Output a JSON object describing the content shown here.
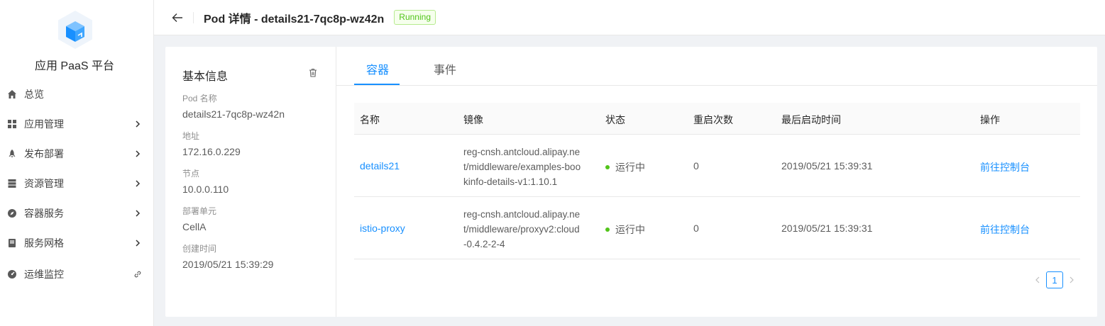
{
  "colors": {
    "primary": "#1890ff",
    "success": "#52c41a"
  },
  "sidebar": {
    "app_title": "应用 PaaS 平台",
    "logo_icon": "cube-logo-icon",
    "items": [
      {
        "label": "总览",
        "icon": "home-icon",
        "has_chevron": false
      },
      {
        "label": "应用管理",
        "icon": "appstore-icon",
        "has_chevron": true
      },
      {
        "label": "发布部署",
        "icon": "rocket-icon",
        "has_chevron": true
      },
      {
        "label": "资源管理",
        "icon": "database-icon",
        "has_chevron": true
      },
      {
        "label": "容器服务",
        "icon": "compass-icon",
        "has_chevron": true
      },
      {
        "label": "服务网格",
        "icon": "book-icon",
        "has_chevron": true
      },
      {
        "label": "运维监控",
        "icon": "dashboard-icon",
        "has_chevron": false,
        "external": true
      }
    ]
  },
  "header": {
    "title": "Pod 详情 - details21-7qc8p-wz42n",
    "status": "Running"
  },
  "info": {
    "title": "基本信息",
    "fields": [
      {
        "label": "Pod 名称",
        "value": "details21-7qc8p-wz42n"
      },
      {
        "label": "地址",
        "value": "172.16.0.229"
      },
      {
        "label": "节点",
        "value": "10.0.0.110"
      },
      {
        "label": "部署单元",
        "value": "CellA"
      },
      {
        "label": "创建时间",
        "value": "2019/05/21 15:39:29"
      }
    ]
  },
  "tabs": [
    {
      "label": "容器",
      "active": true
    },
    {
      "label": "事件",
      "active": false
    }
  ],
  "table": {
    "columns": [
      "名称",
      "镜像",
      "状态",
      "重启次数",
      "最后启动时间",
      "操作"
    ],
    "rows": [
      {
        "name": "details21",
        "image_lines": [
          "reg-cnsh.antcloud.alipay.ne",
          "t/middleware/examples-boo",
          "kinfo-details-v1:1.10.1"
        ],
        "status": "运行中",
        "restarts": "0",
        "last_start": "2019/05/21 15:39:31",
        "action": "前往控制台"
      },
      {
        "name": "istio-proxy",
        "image_lines": [
          "reg-cnsh.antcloud.alipay.ne",
          "t/middleware/proxyv2:cloud",
          "-0.4.2-2-4"
        ],
        "status": "运行中",
        "restarts": "0",
        "last_start": "2019/05/21 15:39:31",
        "action": "前往控制台"
      }
    ]
  },
  "pagination": {
    "current": "1"
  }
}
